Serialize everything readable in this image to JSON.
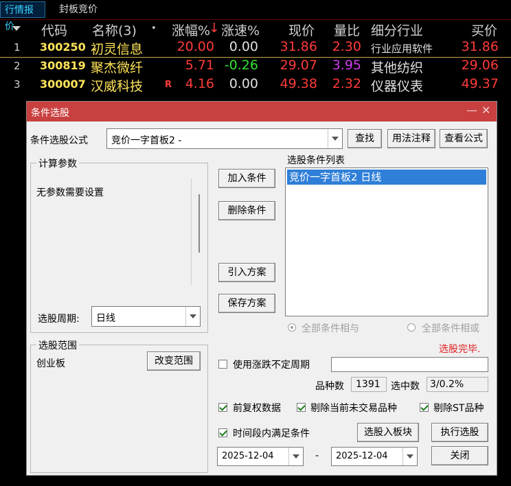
{
  "tabs": [
    "行情报价",
    "封板竞价"
  ],
  "quote_header": {
    "code": "代码",
    "name": "名称(3)",
    "dot": "•",
    "change_pct": "涨幅%",
    "change_arrow": "↓",
    "speed": "涨速%",
    "price": "现价",
    "volume_ratio": "量比",
    "industry": "细分行业",
    "bid": "买价"
  },
  "quote_rows": [
    {
      "idx": "1",
      "code": "300250",
      "name": "初灵信息",
      "flag": "",
      "change_pct": "20.00",
      "speed": "0.00",
      "price": "31.86",
      "volume_ratio": "2.30",
      "industry": "行业应用软件",
      "bid": "31.86"
    },
    {
      "idx": "2",
      "code": "300819",
      "name": "聚杰微纤",
      "flag": "",
      "change_pct": "5.71",
      "speed": "-0.26",
      "price": "29.07",
      "volume_ratio": "3.95",
      "industry": "其他纺织",
      "bid": "29.06"
    },
    {
      "idx": "3",
      "code": "300007",
      "name": "汉威科技",
      "flag": "R",
      "change_pct": "4.16",
      "speed": "0.00",
      "price": "49.38",
      "volume_ratio": "2.32",
      "industry": "仪器仪表",
      "bid": "49.37"
    }
  ],
  "colors": {
    "title_bar": "#c94040",
    "selection": "#2f7fd8",
    "up_red": "#ff3b3b",
    "down_green": "#34e234",
    "stock_yellow": "#ffe45a"
  },
  "dialog": {
    "title": "条件选股",
    "minimize": "—",
    "close": "✕",
    "formula_label": "条件选股公式",
    "formula_value": "竞价一字首板2  -",
    "find_button": "查找",
    "usage_button": "用法注释",
    "view_formula_button": "查看公式",
    "params_group": "计算参数",
    "params_text": "无参数需要设置",
    "period_label": "选股周期:",
    "period_value": "日线",
    "add_condition": "加入条件",
    "delete_condition": "删除条件",
    "import_plan": "引入方案",
    "save_plan": "保存方案",
    "condition_list_label": "选股条件列表",
    "condition_items": [
      "竞价一字首板2  日线"
    ],
    "and_all": "全部条件相与",
    "or_all": "全部条件相或",
    "status": "选股完毕.",
    "range_group": "选股范围",
    "range_value": "创业板",
    "change_range_button": "改变范围",
    "use_irregular_period": "使用涨跌不定周期",
    "variety_count_label": "品种数",
    "variety_count": "1391",
    "selected_label": "选中数",
    "selected_value": "3/0.2%",
    "forward_adjust": "前复权数据",
    "exclude_untraded": "剔除当前未交易品种",
    "exclude_st": "剔除ST品种",
    "period_meet": "时间段内满足条件",
    "select_to_block": "选股入板块",
    "execute": "执行选股",
    "date_from": "2025-12-04",
    "date_dash": "-",
    "date_to": "2025-12-04",
    "close_button": "关闭"
  }
}
